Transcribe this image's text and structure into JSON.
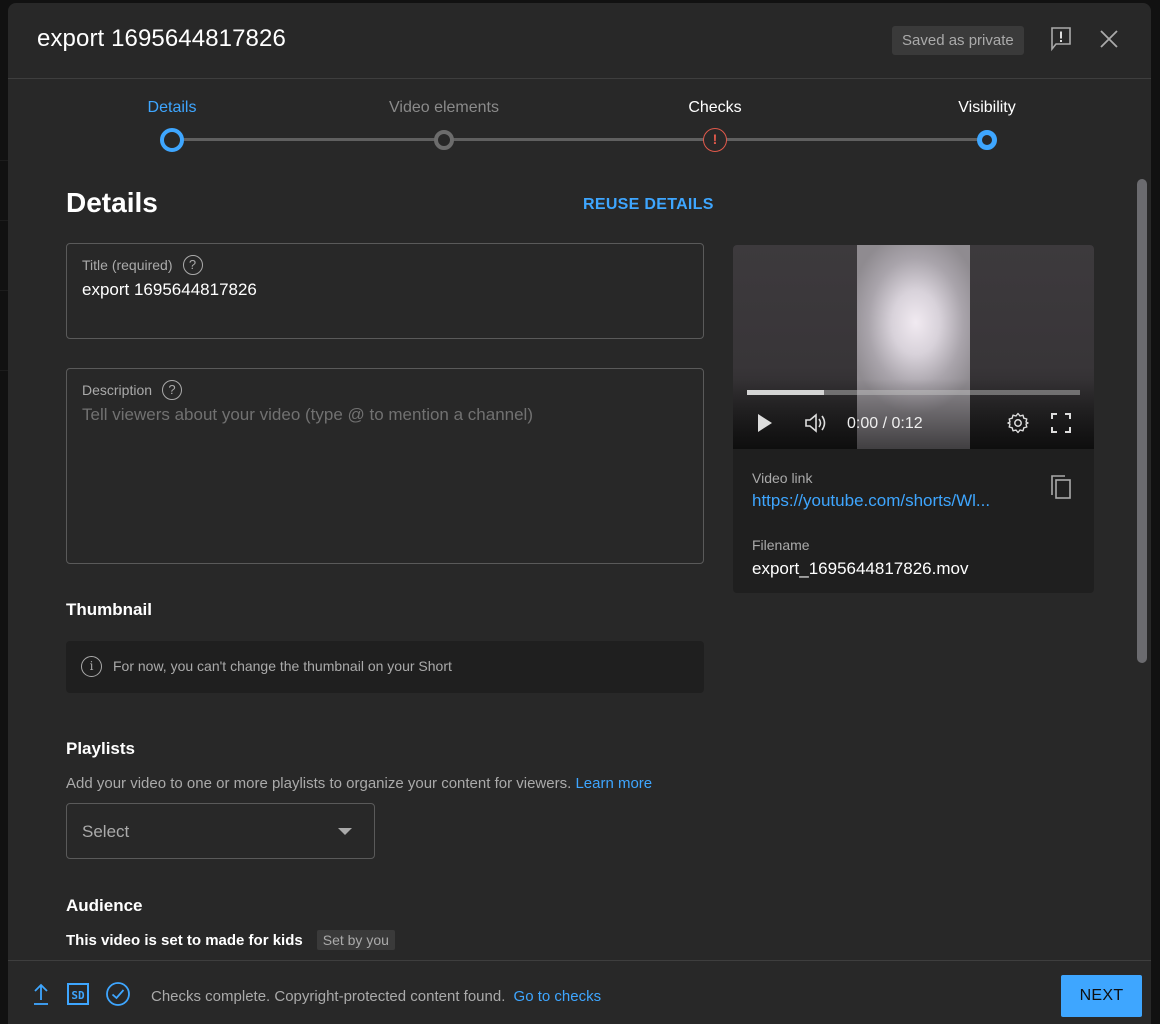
{
  "header": {
    "title": "export 1695644817826",
    "saved_status": "Saved as private",
    "feedback_icon": "feedback-flag-icon",
    "close_icon": "close-icon"
  },
  "stepper": {
    "steps": [
      {
        "label": "Details",
        "state": "current"
      },
      {
        "label": "Video elements",
        "state": "inactive"
      },
      {
        "label": "Checks",
        "state": "warning",
        "icon": "!"
      },
      {
        "label": "Visibility",
        "state": "current"
      }
    ]
  },
  "details": {
    "heading": "Details",
    "reuse_label": "REUSE DETAILS",
    "title_field": {
      "label": "Title (required)",
      "value": "export 1695644817826",
      "help_icon": "?"
    },
    "description_field": {
      "label": "Description",
      "value": "",
      "placeholder": "Tell viewers about your video (type @ to mention a channel)",
      "help_icon": "?"
    },
    "thumbnail": {
      "heading": "Thumbnail",
      "info_icon": "i",
      "notice": "For now, you can't change the thumbnail on your Short"
    },
    "playlists": {
      "heading": "Playlists",
      "description": "Add your video to one or more playlists to organize your content for viewers.",
      "learn_more": "Learn more",
      "select_value": "Select"
    },
    "audience": {
      "heading": "Audience",
      "status": "This video is set to made for kids",
      "badge": "Set by you"
    }
  },
  "preview": {
    "time": "0:00 / 0:12",
    "progress_buffered_fraction": 0.23,
    "video_link_label": "Video link",
    "video_link": "https://youtube.com/shorts/Wl...",
    "filename_label": "Filename",
    "filename": "export_1695644817826.mov"
  },
  "footer": {
    "status": "Checks complete. Copyright-protected content found.",
    "link": "Go to checks",
    "sd_badge": "SD",
    "next_label": "NEXT"
  },
  "colors": {
    "accent": "#3ea6ff",
    "warning": "#e0594b",
    "surface": "#282828"
  }
}
